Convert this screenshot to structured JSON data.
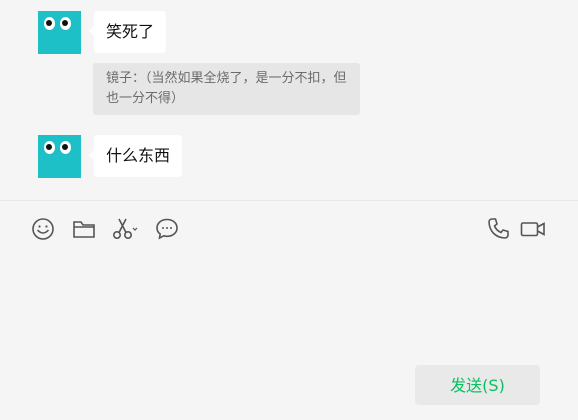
{
  "messages": [
    {
      "text": "笑死了"
    },
    {
      "quote": "镜子：（当然如果全烧了，是一分不扣，但也一分不得）"
    },
    {
      "text": "什么东西"
    }
  ],
  "toolbar": {
    "icons": [
      "emoji-icon",
      "folder-icon",
      "scissors-icon",
      "chat-bubble-icon",
      "phone-icon",
      "video-icon"
    ]
  },
  "send": {
    "label": "发送(S)"
  },
  "colors": {
    "avatar": "#1ec0c8",
    "send_text": "#07c160",
    "background": "#f5f5f5"
  }
}
